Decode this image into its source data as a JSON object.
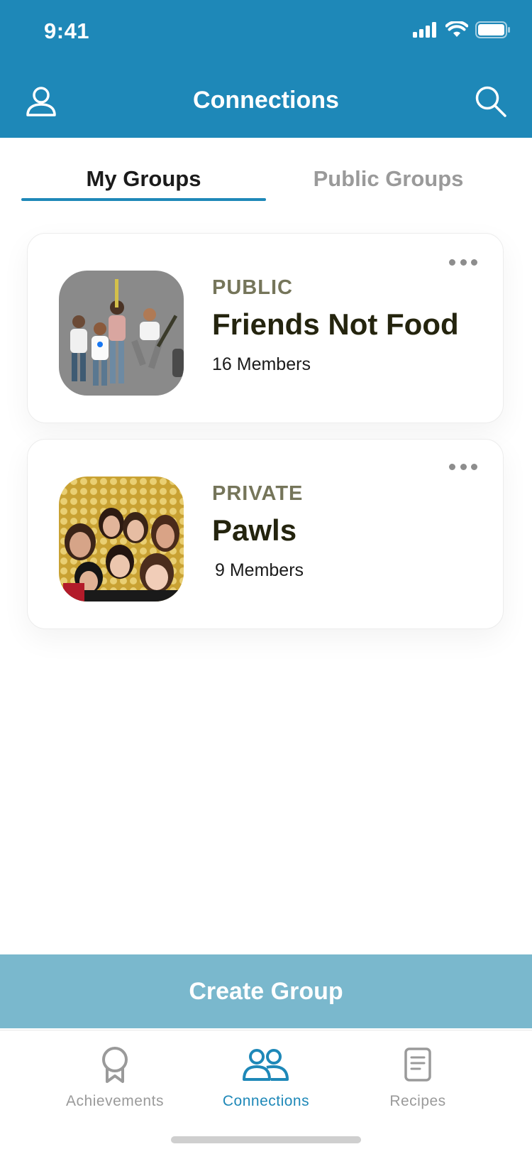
{
  "status_bar": {
    "time": "9:41"
  },
  "header": {
    "title": "Connections",
    "profile_icon": "person-icon",
    "search_icon": "search-icon"
  },
  "tabs": [
    {
      "label": "My Groups",
      "active": true
    },
    {
      "label": "Public Groups",
      "active": false
    }
  ],
  "groups": [
    {
      "privacy": "PUBLIC",
      "name": "Friends Not Food",
      "members": "16 Members",
      "thumbnail": "cartoon-group-illustration"
    },
    {
      "privacy": "PRIVATE",
      "name": "Pawls",
      "members": "9 Members",
      "thumbnail": "group-photo"
    }
  ],
  "create_group_label": "Create Group",
  "bottom_nav": [
    {
      "label": "Achievements",
      "icon": "ribbon-icon",
      "active": false
    },
    {
      "label": "Connections",
      "icon": "people-icon",
      "active": true
    },
    {
      "label": "Recipes",
      "icon": "document-icon",
      "active": false
    }
  ],
  "colors": {
    "brand": "#1e88b8",
    "create_button": "#7ab8cd",
    "privacy_text": "#75755a",
    "group_name": "#24240e",
    "inactive": "#9a9a9a"
  }
}
